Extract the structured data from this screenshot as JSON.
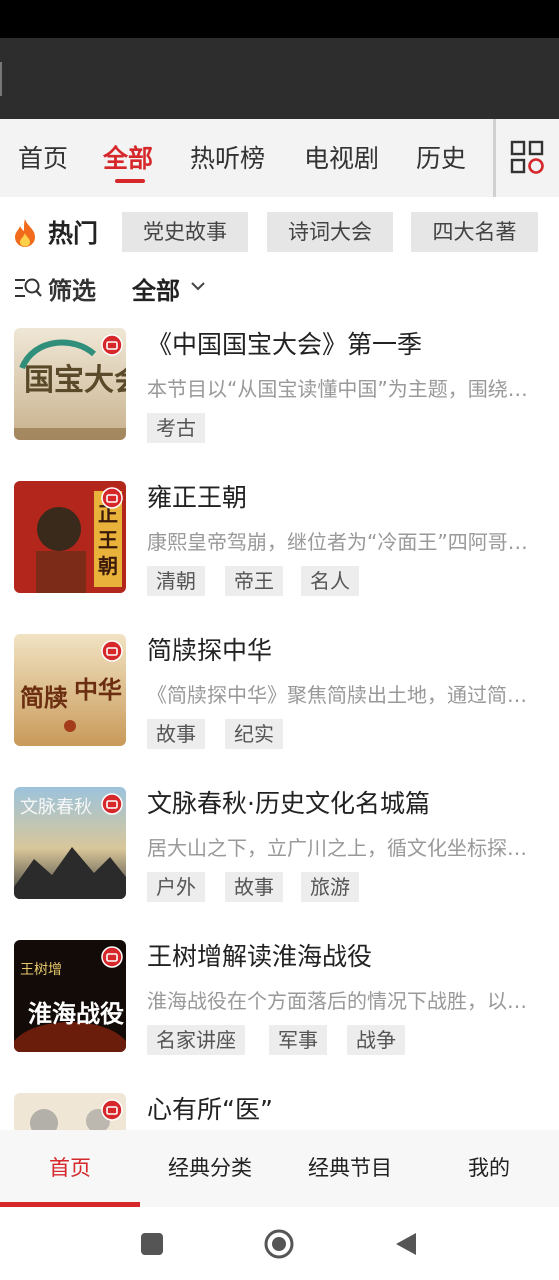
{
  "tabs": [
    {
      "label": "首页"
    },
    {
      "label": "全部"
    },
    {
      "label": "热听榜"
    },
    {
      "label": "电视剧"
    },
    {
      "label": "历史"
    }
  ],
  "active_tab": "全部",
  "hot": {
    "title": "热门",
    "chips": [
      "党史故事",
      "诗词大会",
      "四大名著"
    ]
  },
  "filter": {
    "label": "筛选",
    "value": "全部"
  },
  "items": [
    {
      "title": "《中国国宝大会》第一季",
      "desc": "本节目以“从国宝读懂中国”为主题，围绕国宝讲述中国故事",
      "tags": [
        "考古"
      ],
      "cover_text": "国宝大会"
    },
    {
      "title": "雍正王朝",
      "desc": "康熙皇帝驾崩，继位者为“冷面王”四阿哥胤禛",
      "tags": [
        "清朝",
        "帝王",
        "名人"
      ],
      "cover_text": "雍正王朝"
    },
    {
      "title": "简牍探中华",
      "desc": "《简牍探中华》聚焦简牍出土地，通过简牍讲述中华文明",
      "tags": [
        "故事",
        "纪实"
      ],
      "cover_text": "简牍探中华"
    },
    {
      "title": "文脉春秋·历史文化名城篇",
      "desc": "居大山之下，立广川之上，循文化坐标探寻名城",
      "tags": [
        "户外",
        "故事",
        "旅游"
      ],
      "cover_text": "文脉春秋"
    },
    {
      "title": "王树增解读淮海战役",
      "desc": "淮海战役在个方面落后的情况下战胜，以少胜多",
      "tags": [
        "名家讲座",
        "军事",
        "战争"
      ],
      "cover_text": "淮海战役"
    },
    {
      "title": "心有所“医”",
      "desc": "",
      "tags": [],
      "cover_text": ""
    }
  ],
  "bottom_nav": [
    "首页",
    "经典分类",
    "经典节目",
    "我的"
  ],
  "colors": {
    "accent": "#d6282b",
    "tab_bg": "#f3f3f3",
    "chip_bg": "#e6e6e6"
  }
}
